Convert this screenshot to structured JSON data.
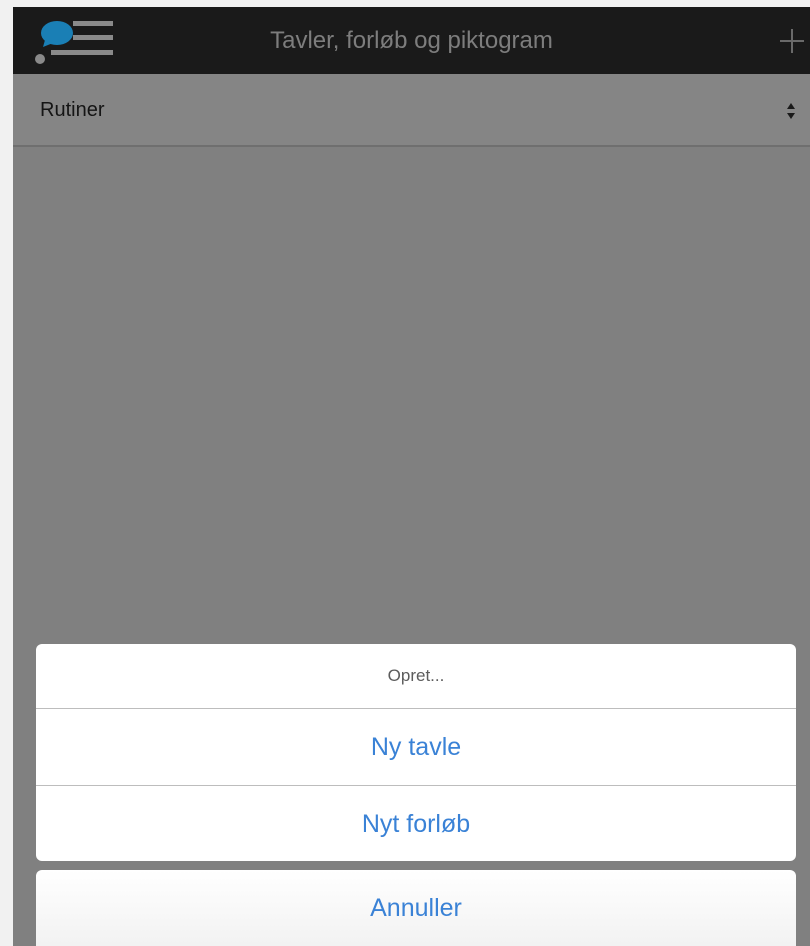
{
  "header": {
    "logo_icon": "app-logo-icon",
    "title": "Tavler, forløb og piktogram",
    "add_icon": "plus-icon"
  },
  "filter": {
    "selected": "Rutiner",
    "arrows_icon": "select-arrows-icon"
  },
  "action_sheet": {
    "title": "Opret...",
    "options": [
      "Ny tavle",
      "Nyt forløb"
    ],
    "cancel_label": "Annuller"
  },
  "colors": {
    "topbar": "#1a1a1a",
    "overlay": "#808080",
    "accent": "#3a82d6",
    "logo_blue": "#1a7fb5"
  }
}
